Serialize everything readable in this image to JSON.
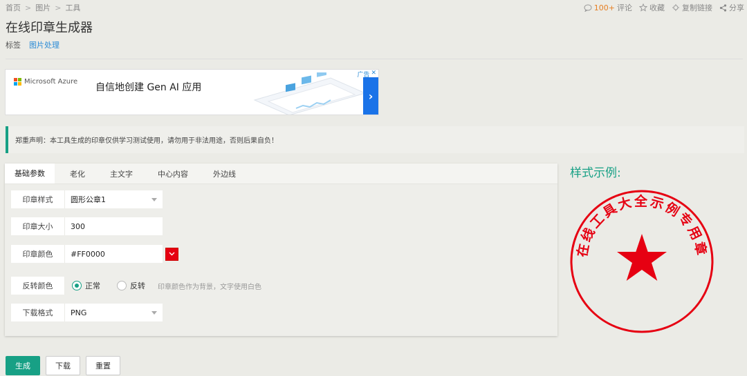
{
  "breadcrumb": {
    "items": [
      "首页",
      "图片",
      "工具"
    ],
    "separator": ">"
  },
  "top_actions": {
    "comment_count": "100+",
    "comment_label": "评论",
    "favorite_label": "收藏",
    "copy_link_label": "复制链接",
    "share_label": "分享"
  },
  "page": {
    "title": "在线印章生成器",
    "tag_label": "标签",
    "tag_link": "图片处理"
  },
  "ad": {
    "brand": "Microsoft Azure",
    "headline": "自信地创建 Gen AI 应用",
    "ad_tag": "广告",
    "close": "✕",
    "arrow": "›"
  },
  "notice": "郑重声明：本工具生成的印章仅供学习测试使用，请勿用于非法用途，否则后果自负！",
  "tabs": [
    "基础参数",
    "老化",
    "主文字",
    "中心内容",
    "外边线"
  ],
  "form": {
    "style_label": "印章样式",
    "style_value": "圆形公章1",
    "size_label": "印章大小",
    "size_value": "300",
    "color_label": "印章颜色",
    "color_value": "#FF0000",
    "invert_label": "反转颜色",
    "invert_normal": "正常",
    "invert_reverse": "反转",
    "invert_hint": "印章颜色作为背景，文字使用白色",
    "format_label": "下载格式",
    "format_value": "PNG"
  },
  "preview": {
    "title": "样式示例:",
    "seal_text": "在线工具大全示例专用章",
    "seal_color": "#e60012"
  },
  "buttons": {
    "generate": "生成",
    "download": "下载",
    "reset": "重置"
  },
  "colors": {
    "accent": "#17a085",
    "link": "#2a8bd6",
    "seal": "#e60012"
  }
}
